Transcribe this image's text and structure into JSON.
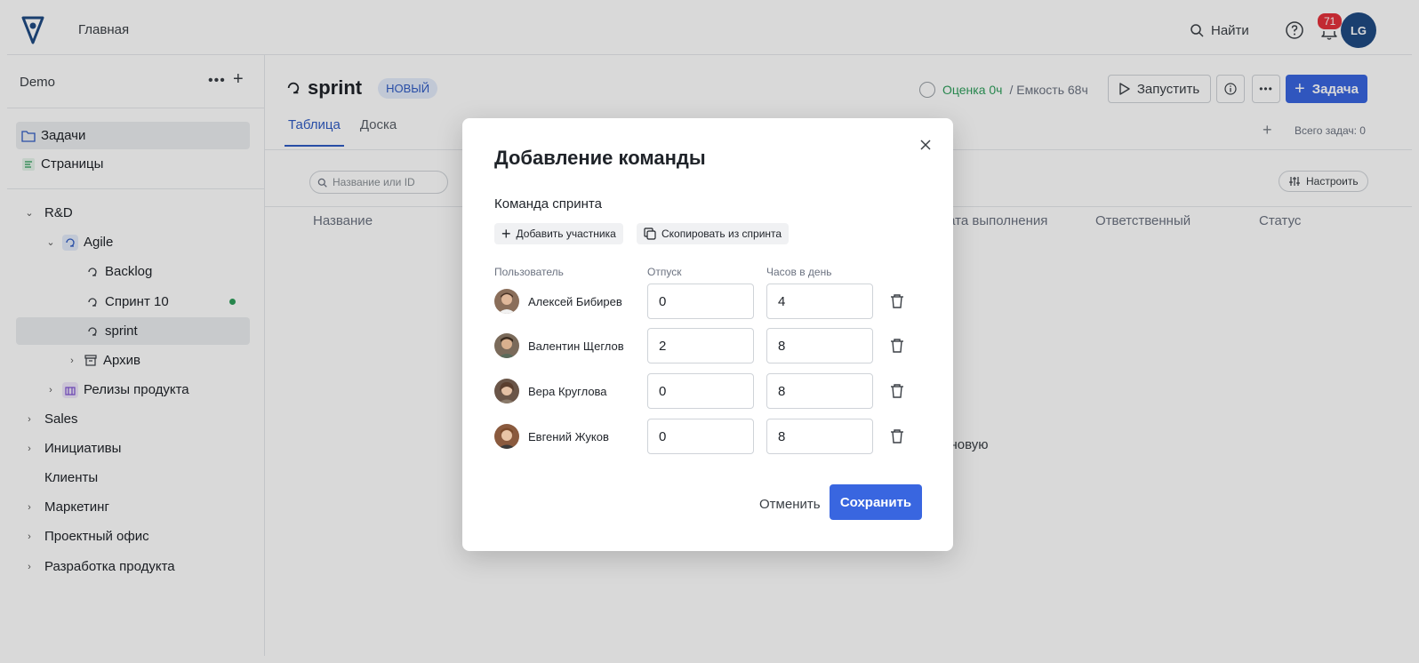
{
  "topbar": {
    "home_label": "Главная",
    "search_label": "Найти",
    "notifications_count": "71",
    "user_initials": "LG"
  },
  "sidebar": {
    "workspace": "Demo",
    "nav": [
      {
        "label": "Задачи"
      },
      {
        "label": "Страницы"
      }
    ],
    "tree": [
      {
        "label": "R&D"
      },
      {
        "label": "Agile"
      },
      {
        "label": "Backlog"
      },
      {
        "label": "Спринт 10"
      },
      {
        "label": "sprint"
      },
      {
        "label": "Архив"
      },
      {
        "label": "Релизы продукта"
      },
      {
        "label": "Sales"
      },
      {
        "label": "Инициативы"
      },
      {
        "label": "Клиенты"
      },
      {
        "label": "Маркетинг"
      },
      {
        "label": "Проектный офис"
      },
      {
        "label": "Разработка продукта"
      }
    ]
  },
  "main": {
    "title": "sprint",
    "badge": "НОВЫЙ",
    "estimate": "Оценка 0ч",
    "capacity": "/ Емкость 68ч",
    "start_label": "Запустить",
    "task_label": "Задача",
    "tabs": [
      {
        "label": "Таблица"
      },
      {
        "label": "Доска"
      }
    ],
    "total_tasks": "Всего задач: 0",
    "search_placeholder": "Название или ID",
    "configure_label": "Настроить",
    "columns": {
      "name": "Название",
      "due": "Дата выполнения",
      "assignee": "Ответственный",
      "status": "Статус"
    },
    "empty_fragment": "е новую"
  },
  "modal": {
    "title": "Добавление команды",
    "section": "Команда спринта",
    "add_member_label": "Добавить участника",
    "copy_label": "Скопировать из спринта",
    "col_user": "Пользователь",
    "col_vacation": "Отпуск",
    "col_hours": "Часов в день",
    "members": [
      {
        "name": "Алексей Бибирев",
        "vacation": "0",
        "hours": "4"
      },
      {
        "name": "Валентин Щеглов",
        "vacation": "2",
        "hours": "8"
      },
      {
        "name": "Вера Круглова",
        "vacation": "0",
        "hours": "8"
      },
      {
        "name": "Евгений Жуков",
        "vacation": "0",
        "hours": "8"
      }
    ],
    "cancel_label": "Отменить",
    "save_label": "Сохранить"
  },
  "colors": {
    "primary": "#3966e0",
    "success": "#2e9e5b",
    "badge_red": "#e4323b",
    "avatar_bg": "#1f4b83"
  }
}
